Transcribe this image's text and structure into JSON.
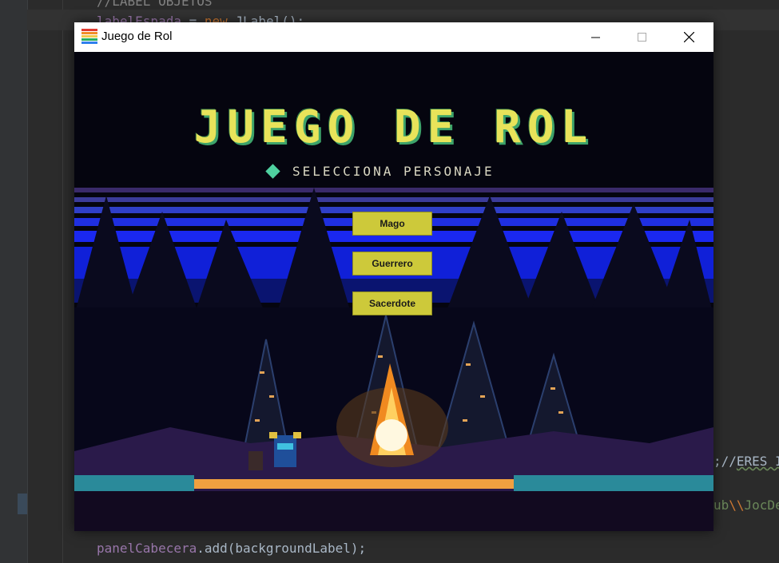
{
  "ide": {
    "line1": "//LABEL OBJETOS",
    "line2_a": "labelEspada",
    "line2_b": " = ",
    "line2_c": "new",
    "line2_d": " JLabel();",
    "right1_a": ";//",
    "right1_b": "ERES I",
    "right2_a": "ub",
    "right2_b": "\\\\",
    "right2_c": "JocDe",
    "bottom_a": "panelCabecera",
    "bottom_b": ".add(backgroundLabel);"
  },
  "window": {
    "title": "Juego de Rol",
    "minimize_icon": "minimize-icon",
    "maximize_icon": "maximize-icon",
    "close_icon": "close-icon"
  },
  "game": {
    "title": "JUEGO DE ROL",
    "subtitle": "SELECCIONA PERSONAJE",
    "characters": [
      {
        "label": "Mago"
      },
      {
        "label": "Guerrero"
      },
      {
        "label": "Sacerdote"
      }
    ]
  },
  "colors": {
    "button_bg": "#cdc93a",
    "title_yellow": "#e8e35a",
    "title_shadow": "#3da36a",
    "ide_bg": "#2b2b2b"
  }
}
